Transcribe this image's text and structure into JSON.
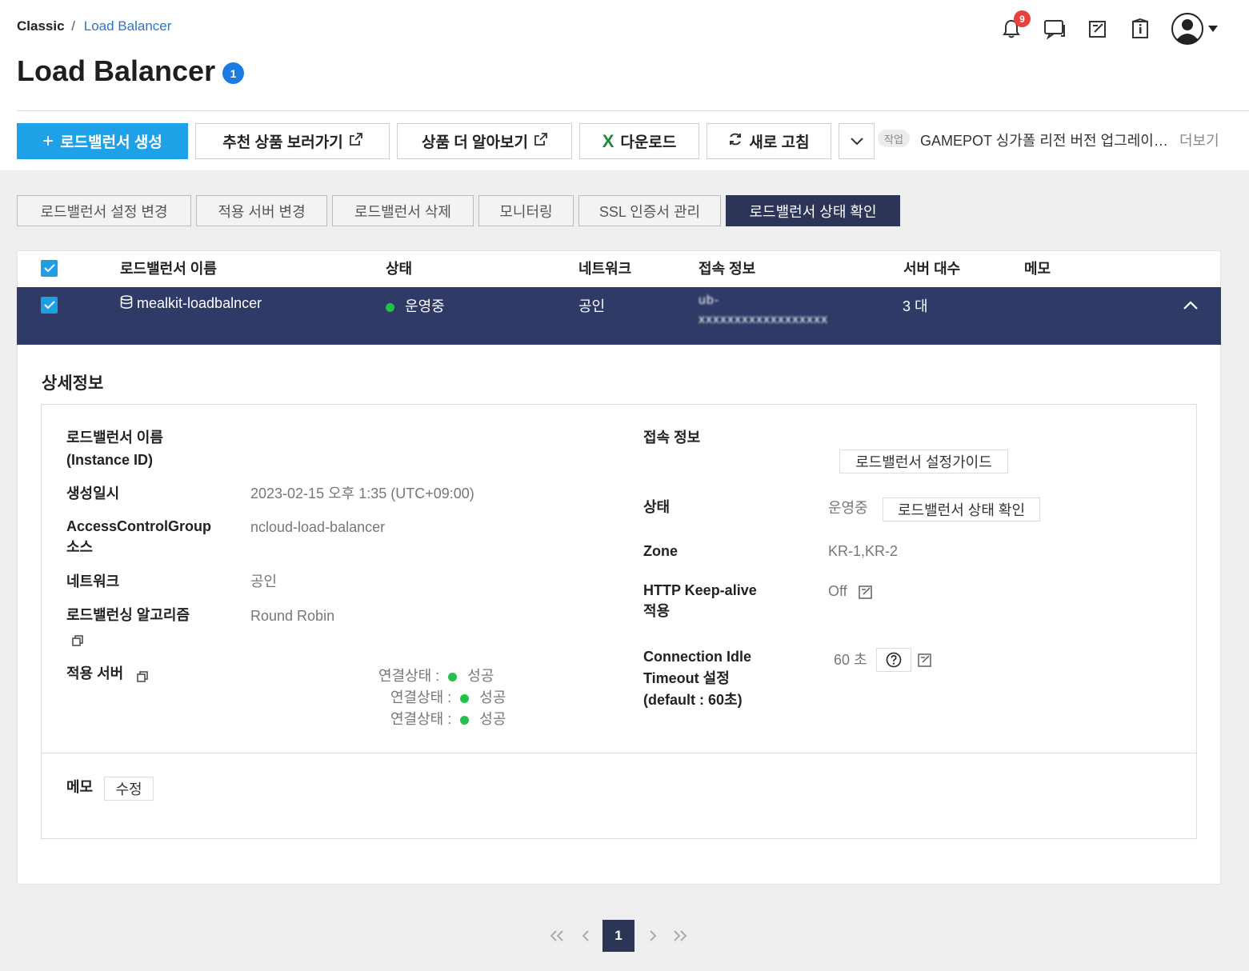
{
  "breadcrumb": {
    "root": "Classic",
    "separator": "/",
    "current": "Load Balancer"
  },
  "page": {
    "title": "Load Balancer",
    "count_badge": "1"
  },
  "header": {
    "notification_count": "9"
  },
  "toolbar": {
    "create_label": "로드밸런서 생성",
    "recommend_label": "추천 상품 보러가기",
    "learn_more_label": "상품 더 알아보기",
    "download_label": "다운로드",
    "refresh_label": "새로 고침",
    "task_tag": "작업",
    "task_text": "GAMEPOT 싱가폴 리전 버전 업그레이드 안내",
    "more_label": "더보기"
  },
  "actions": [
    "로드밸런서 설정 변경",
    "적용 서버 변경",
    "로드밸런서 삭제",
    "모니터링",
    "SSL 인증서 관리",
    "로드밸런서 상태 확인"
  ],
  "table": {
    "headers": {
      "name": "로드밸런서 이름",
      "status": "상태",
      "network": "네트워크",
      "access": "접속 정보",
      "servers": "서버 대수",
      "memo": "메모"
    },
    "row": {
      "name": "mealkit-loadbalncer",
      "status": "운영중",
      "network": "공인",
      "access_line1": "ub-",
      "access_line2": "xxxxxxxxxxxxxxxxxx",
      "servers": "3 대"
    }
  },
  "detail": {
    "title": "상세정보",
    "labels": {
      "name_l1": "로드밸런서 이름",
      "name_l2": "(Instance ID)",
      "created": "생성일시",
      "acg_l1": "AccessControlGroup",
      "acg_l2": "소스",
      "network": "네트워크",
      "algorithm": "로드밸런싱 알고리즘",
      "servers": "적용 서버",
      "access": "접속 정보",
      "status": "상태",
      "zone": "Zone",
      "keepalive_l1": "HTTP Keep-alive",
      "keepalive_l2": "적용",
      "idle_l1": "Connection Idle",
      "idle_l2": "Timeout 설정",
      "idle_l3": "(default : 60초)",
      "memo": "메모"
    },
    "values": {
      "created": "2023-02-15 오후 1:35 (UTC+09:00)",
      "acg": "ncloud-load-balancer",
      "network": "공인",
      "algorithm": "Round Robin",
      "status": "운영중",
      "zone": "KR-1,KR-2",
      "keepalive": "Off",
      "idle": "60 초"
    },
    "buttons": {
      "guide": "로드밸런서 설정가이드",
      "status_check": "로드밸런서 상태 확인",
      "memo_edit": "수정"
    },
    "connection_label": "연결상태 :",
    "connection_value": "성공"
  },
  "pagination": {
    "current": "1"
  },
  "colors": {
    "primary": "#1ea1e6",
    "navy": "#2c3558",
    "row": "#2f3a66",
    "success": "#22c24a",
    "badge": "#1b7be0",
    "alert": "#e8413b"
  }
}
